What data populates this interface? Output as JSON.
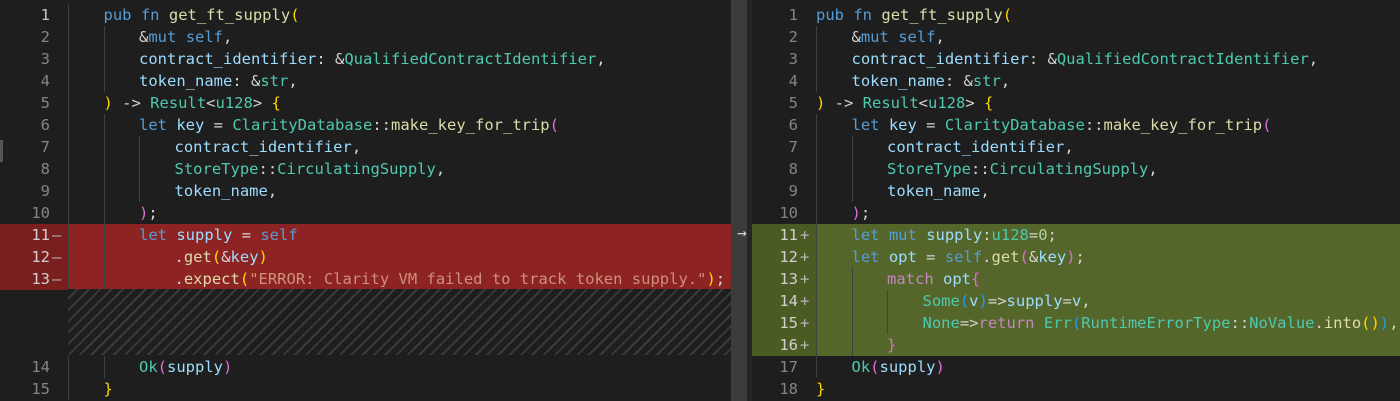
{
  "diff": {
    "arrow": "→",
    "left": {
      "line_numbers": [
        "1",
        "2",
        "3",
        "4",
        "5",
        "6",
        "7",
        "8",
        "9",
        "10",
        "11",
        "12",
        "13",
        "14",
        "15"
      ],
      "change_signs": [
        "",
        "",
        "",
        "",
        "",
        "",
        "",
        "",
        "",
        "",
        "—",
        "—",
        "—",
        "",
        ""
      ],
      "code": {
        "l1": [
          "pub",
          " ",
          "fn",
          " ",
          "get_ft_supply",
          "("
        ],
        "l2": [
          "&",
          "mut",
          " ",
          "self",
          ","
        ],
        "l3": [
          "contract_identifier",
          ": &",
          "QualifiedContractIdentifier",
          ","
        ],
        "l4": [
          "token_name",
          ": &",
          "str",
          ","
        ],
        "l5": [
          ")",
          " -> ",
          "Result",
          "<",
          "u128",
          "> ",
          "{"
        ],
        "l6": [
          "let",
          " ",
          "key",
          " = ",
          "ClarityDatabase",
          "::",
          "make_key_for_trip",
          "("
        ],
        "l7": [
          "contract_identifier",
          ","
        ],
        "l8": [
          "StoreType",
          "::",
          "CirculatingSupply",
          ","
        ],
        "l9": [
          "token_name",
          ","
        ],
        "l10": [
          ")",
          ";"
        ],
        "l11": [
          "let",
          " ",
          "supply",
          " = ",
          "self"
        ],
        "l12": [
          ".",
          "get",
          "(",
          "&",
          "key",
          ")"
        ],
        "l13": [
          ".",
          "expect",
          "(",
          "\"ERROR: Clarity VM failed to track token supply.\"",
          ")",
          ";"
        ],
        "l14": [
          "Ok",
          "(",
          "supply",
          ")"
        ],
        "l15": [
          "}"
        ]
      }
    },
    "right": {
      "line_numbers": [
        "1",
        "2",
        "3",
        "4",
        "5",
        "6",
        "7",
        "8",
        "9",
        "10",
        "11",
        "12",
        "13",
        "14",
        "15",
        "16",
        "17",
        "18"
      ],
      "change_signs": [
        "",
        "",
        "",
        "",
        "",
        "",
        "",
        "",
        "",
        "",
        "+",
        "+",
        "+",
        "+",
        "+",
        "+",
        "",
        ""
      ],
      "code": {
        "l1": [
          "pub",
          " ",
          "fn",
          " ",
          "get_ft_supply",
          "("
        ],
        "l2": [
          "&",
          "mut",
          " ",
          "self",
          ","
        ],
        "l3": [
          "contract_identifier",
          ": &",
          "QualifiedContractIdentifier",
          ","
        ],
        "l4": [
          "token_name",
          ": &",
          "str",
          ","
        ],
        "l5": [
          ")",
          " -> ",
          "Result",
          "<",
          "u128",
          "> ",
          "{"
        ],
        "l6": [
          "let",
          " ",
          "key",
          " = ",
          "ClarityDatabase",
          "::",
          "make_key_for_trip",
          "("
        ],
        "l7": [
          "contract_identifier",
          ","
        ],
        "l8": [
          "StoreType",
          "::",
          "CirculatingSupply",
          ","
        ],
        "l9": [
          "token_name",
          ","
        ],
        "l10": [
          ")",
          ";"
        ],
        "l11": [
          "let",
          " ",
          "mut",
          " ",
          "supply",
          ":",
          "u128",
          "=",
          "0",
          ";"
        ],
        "l12": [
          "let",
          " ",
          "opt",
          " = ",
          "self",
          ".",
          "get",
          "(",
          "&",
          "key",
          ")",
          ";"
        ],
        "l13": [
          "match",
          " ",
          "opt",
          "{"
        ],
        "l14": [
          "Some",
          "(",
          "v",
          ")",
          "=>",
          "supply",
          "=",
          "v",
          ","
        ],
        "l15": [
          "None",
          "=>",
          "return",
          " ",
          "Err",
          "(",
          "RuntimeErrorType",
          "::",
          "NoValue",
          ".",
          "into",
          "(",
          ")",
          ")",
          ","
        ],
        "l16": [
          "}"
        ],
        "l17": [
          "Ok",
          "(",
          "supply",
          ")"
        ],
        "l18": [
          "}"
        ]
      }
    }
  }
}
